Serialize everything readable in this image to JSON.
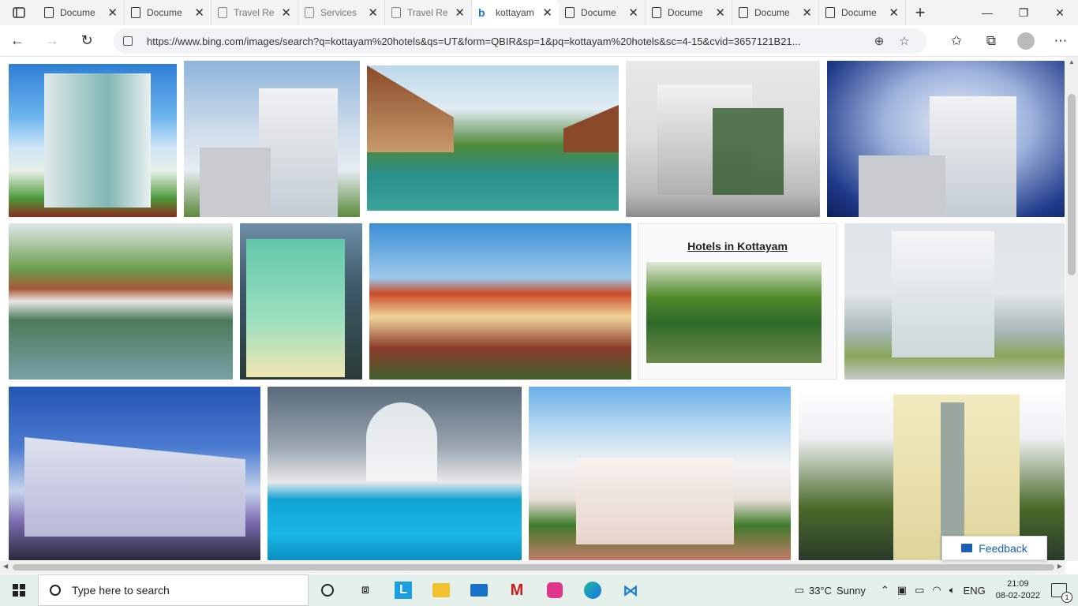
{
  "tabs": [
    {
      "label": "Docume",
      "active": false,
      "faded": false
    },
    {
      "label": "Docume",
      "active": false,
      "faded": false
    },
    {
      "label": "Travel Re",
      "active": false,
      "faded": true
    },
    {
      "label": "Services",
      "active": false,
      "faded": true
    },
    {
      "label": "Travel Re",
      "active": false,
      "faded": true
    },
    {
      "label": "kottayam",
      "active": true,
      "faded": false
    },
    {
      "label": "Docume",
      "active": false,
      "faded": false
    },
    {
      "label": "Docume",
      "active": false,
      "faded": false
    },
    {
      "label": "Docume",
      "active": false,
      "faded": false
    },
    {
      "label": "Docume",
      "active": false,
      "faded": false
    }
  ],
  "address_bar": {
    "url": "https://www.bing.com/images/search?q=kottayam%20hotels&qs=UT&form=QBIR&sp=1&pq=kottayam%20hotels&sc=4-15&cvid=3657121B21..."
  },
  "images": {
    "sign_text": "Hotels in Kottayam"
  },
  "feedback": {
    "label": "Feedback"
  },
  "taskbar": {
    "search_placeholder": "Type here to search",
    "weather_temp": "33°C",
    "weather_text": "Sunny",
    "language": "ENG",
    "time": "21:09",
    "date": "08-02-2022",
    "notifications": "1"
  },
  "colors": {
    "accent": "#1a73e8",
    "taskbar": "#e6f0eb",
    "feedback": "#1a5fb4"
  }
}
